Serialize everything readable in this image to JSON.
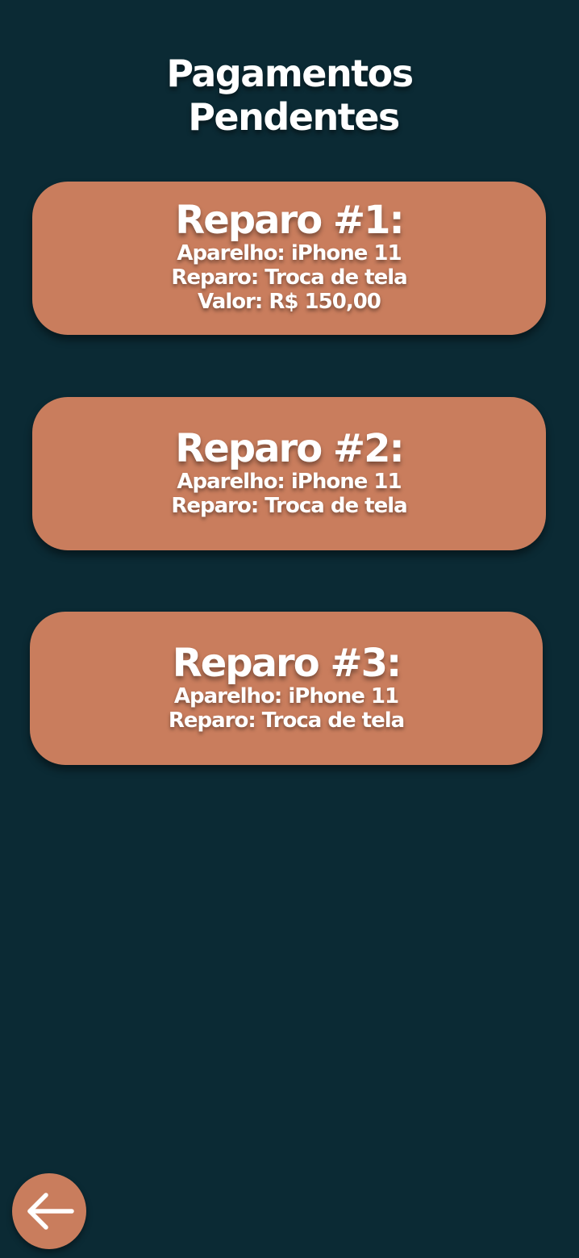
{
  "header": {
    "title_line1": "Pagamentos",
    "title_line2": "Pendentes"
  },
  "repairs": [
    {
      "title": "Reparo #1:",
      "device": "Aparelho: iPhone 11",
      "repair": "Reparo: Troca de tela",
      "value": "Valor: R$ 150,00"
    },
    {
      "title": "Reparo #2:",
      "device": "Aparelho: iPhone 11",
      "repair": "Reparo: Troca de tela"
    },
    {
      "title": "Reparo #3:",
      "device": "Aparelho: iPhone 11",
      "repair": "Reparo: Troca de tela"
    }
  ],
  "navigation": {
    "back_icon": "arrow-left-icon"
  },
  "colors": {
    "background": "#0b2a34",
    "card": "#c97d5d",
    "text": "#ffffff"
  }
}
